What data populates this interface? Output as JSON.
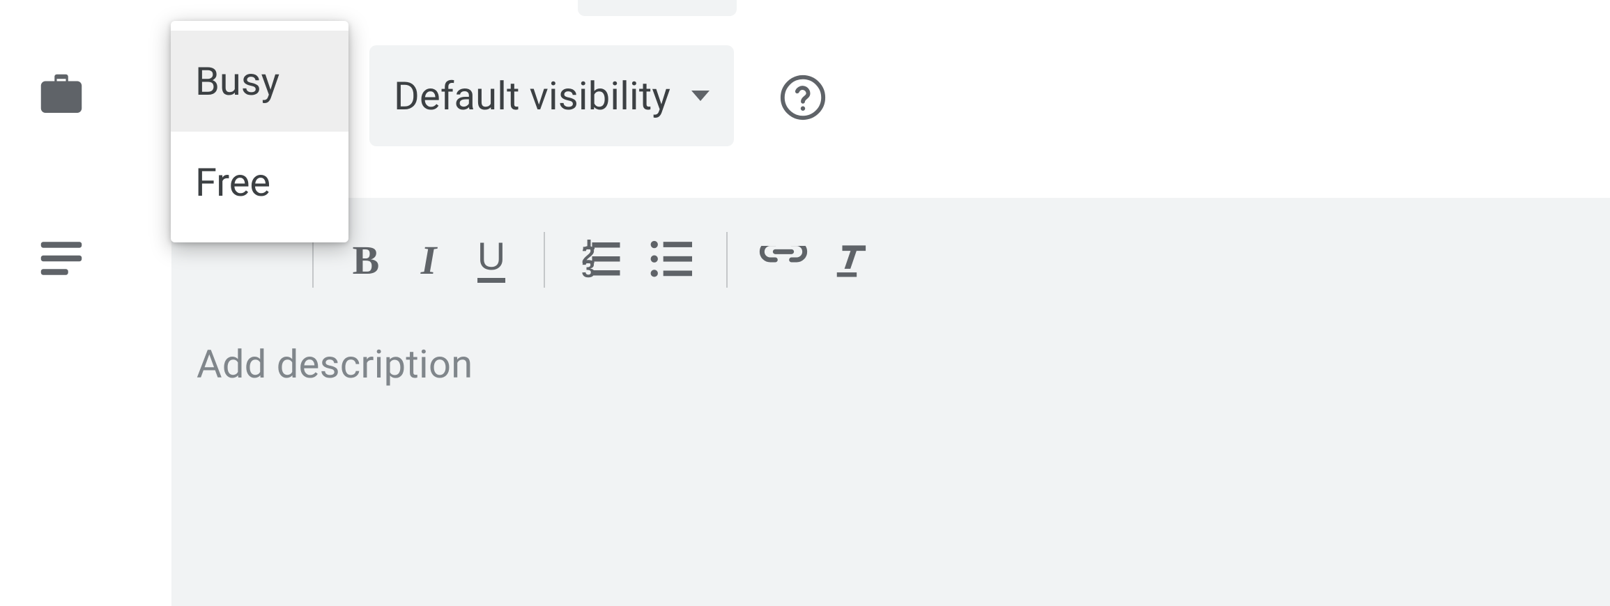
{
  "availability": {
    "options": [
      "Busy",
      "Free"
    ],
    "selected": "Busy"
  },
  "visibility": {
    "label": "Default visibility"
  },
  "description": {
    "placeholder": "Add description"
  }
}
